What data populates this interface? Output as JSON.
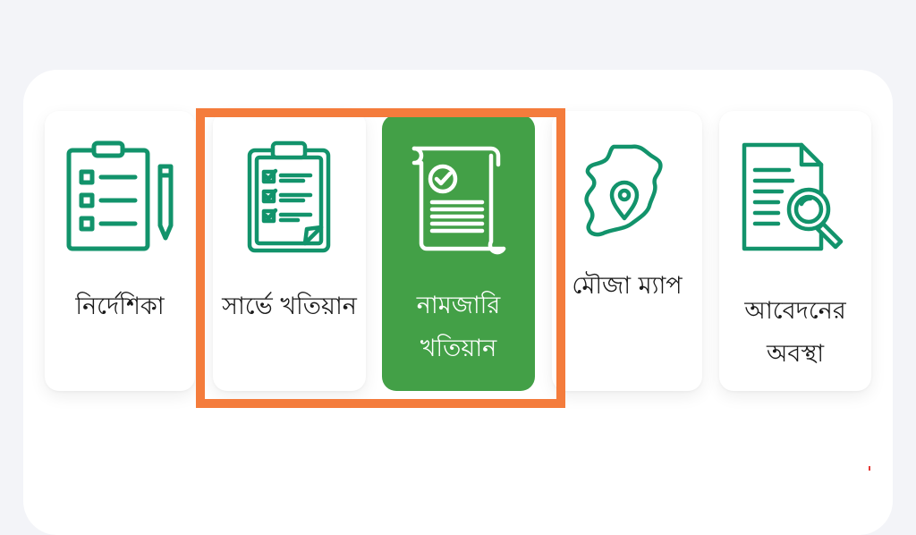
{
  "colors": {
    "page_bg": "#f3f4f8",
    "accent_green": "#12936b",
    "active_green": "#43a047",
    "highlight_orange": "#f47c3c"
  },
  "menu": {
    "items": [
      {
        "label": "নির্দেশিকা",
        "icon": "clipboard-pencil-icon"
      },
      {
        "label": "সার্ভে খতিয়ান",
        "icon": "clipboard-checklist-icon"
      },
      {
        "label": "নামজারি খতিয়ান",
        "icon": "scroll-document-icon",
        "selected": true
      },
      {
        "label": "মৌজা ম্যাপ",
        "icon": "map-location-icon"
      },
      {
        "label": "আবেদনের অবস্থা",
        "icon": "document-search-icon"
      }
    ]
  }
}
